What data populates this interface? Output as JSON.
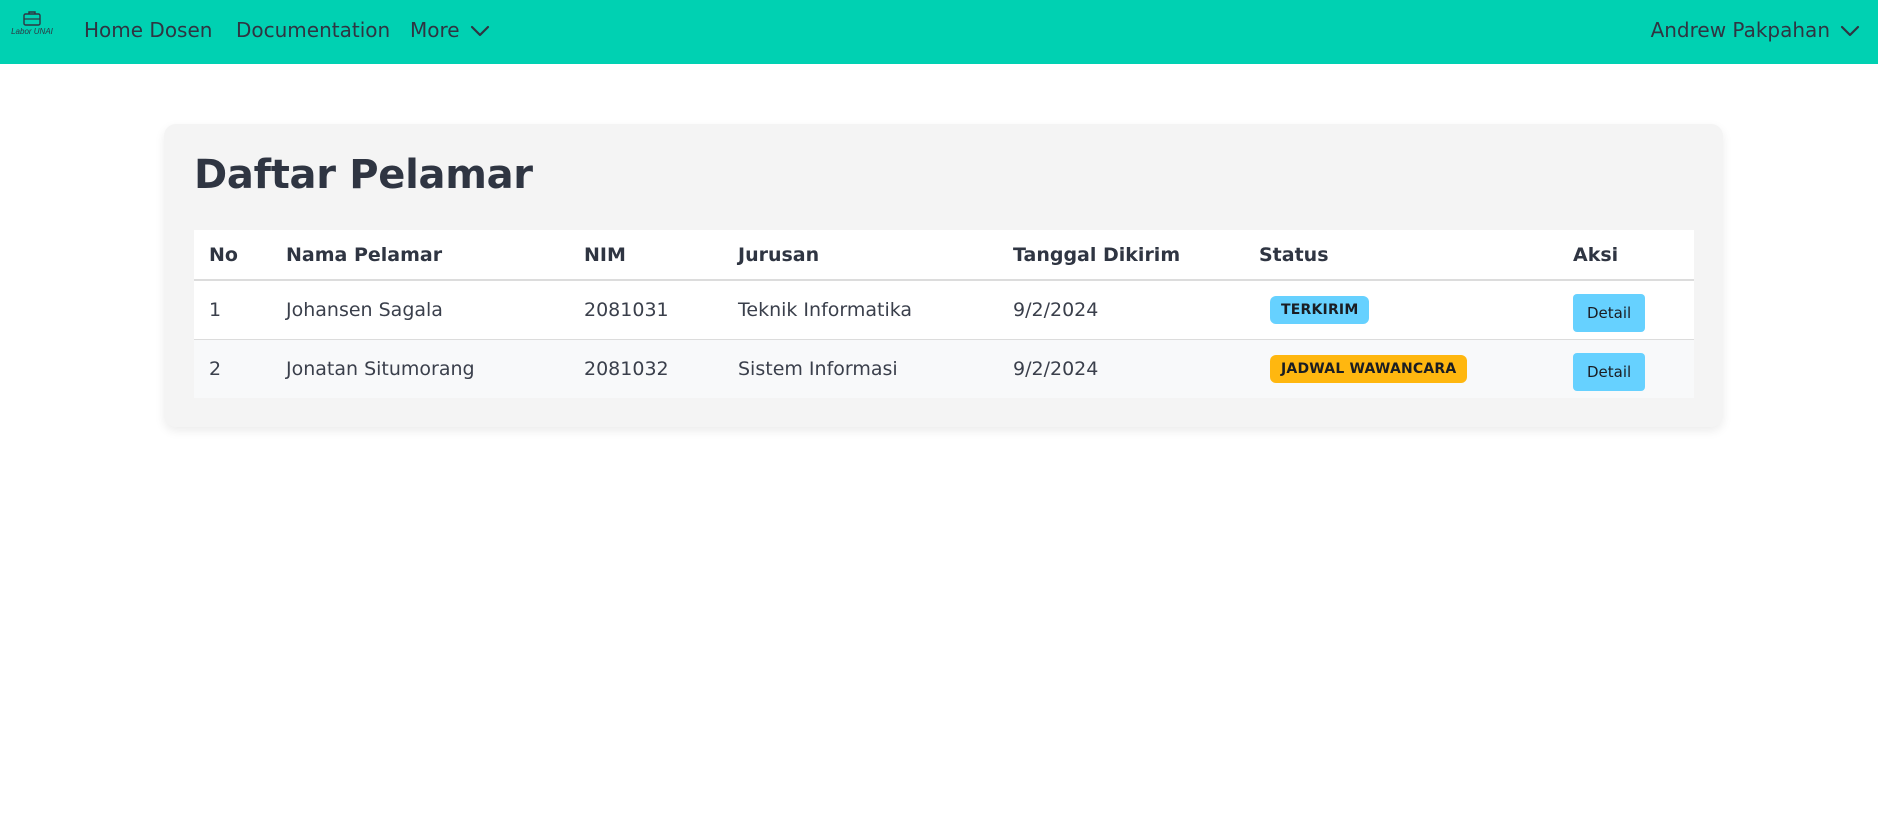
{
  "navbar": {
    "brand_text": "Labor UNAI",
    "home_label": "Home Dosen",
    "docs_label": "Documentation",
    "more_label": "More",
    "user_name": "Andrew Pakpahan",
    "background_color": "#00d1b2"
  },
  "page": {
    "title": "Daftar Pelamar"
  },
  "table": {
    "headers": {
      "no": "No",
      "nama": "Nama Pelamar",
      "nim": "NIM",
      "jurusan": "Jurusan",
      "tanggal": "Tanggal Dikirim",
      "status": "Status",
      "aksi": "Aksi"
    },
    "rows": [
      {
        "no": "1",
        "nama": "Johansen Sagala",
        "nim": "2081031",
        "jurusan": "Teknik Informatika",
        "tanggal": "9/2/2024",
        "status": "TERKIRIM",
        "status_color": "#66d1ff",
        "action_label": "Detail"
      },
      {
        "no": "2",
        "nama": "Jonatan Situmorang",
        "nim": "2081032",
        "jurusan": "Sistem Informasi",
        "tanggal": "9/2/2024",
        "status": "JADWAL WAWANCARA",
        "status_color": "#ffb70f",
        "action_label": "Detail"
      }
    ]
  },
  "icons": {
    "brand": "briefcase-logo-icon",
    "more_chevron": "chevron-down-icon",
    "user_chevron": "chevron-down-icon"
  }
}
